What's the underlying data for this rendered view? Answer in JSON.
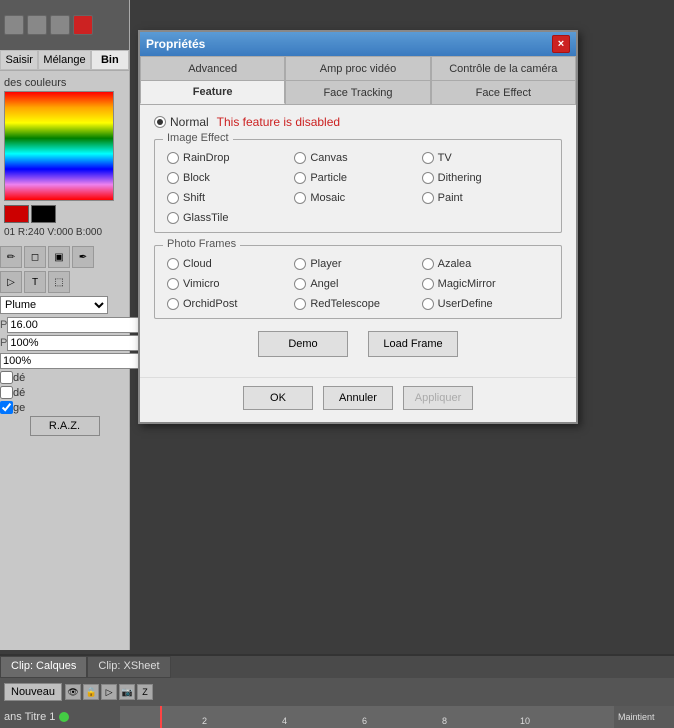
{
  "app": {
    "title": "Propriétés"
  },
  "sidebar": {
    "tabs": [
      "Saisir",
      "Mélange",
      "Bin"
    ],
    "active_tab": "Bin",
    "color_label": "des couleurs",
    "rgb_display": "01 R:240 V:000 B:000",
    "params": [
      {
        "label": "P",
        "value": "16.00"
      },
      {
        "label": "P",
        "value": "100%"
      },
      {
        "label": "",
        "value": "100%"
      }
    ],
    "raz_label": "R.A.Z."
  },
  "dialog": {
    "title": "Propriétés",
    "close_label": "×",
    "tabs": [
      {
        "label": "Advanced",
        "active": false
      },
      {
        "label": "Amp proc vidéo",
        "active": false
      },
      {
        "label": "Contrôle de la caméra",
        "active": false
      },
      {
        "label": "Feature",
        "active": true
      },
      {
        "label": "Face Tracking",
        "active": false
      },
      {
        "label": "Face Effect",
        "active": false
      }
    ],
    "feature_section": {
      "normal_label": "Normal",
      "disabled_text": "This feature is disabled"
    },
    "image_effect": {
      "title": "Image Effect",
      "items": [
        "RainDrop",
        "Canvas",
        "TV",
        "Block",
        "Particle",
        "Dithering",
        "Shift",
        "Mosaic",
        "Paint",
        "GlassTile"
      ]
    },
    "photo_frames": {
      "title": "Photo Frames",
      "items": [
        "Cloud",
        "Player",
        "Azalea",
        "Vimicro",
        "Angel",
        "MagicMirror",
        "OrchidPost",
        "RedTelescope",
        "UserDefine"
      ]
    },
    "demo_button": "Demo",
    "load_frame_button": "Load Frame",
    "footer": {
      "ok": "OK",
      "cancel": "Annuler",
      "apply": "Appliquer"
    }
  },
  "timeline": {
    "tabs": [
      "Clip: Calques",
      "Clip: XSheet"
    ],
    "active_tab": "Clip: Calques",
    "new_label": "Nouveau",
    "layer_label": "ans Titre 1",
    "time_label": "Maintient",
    "ruler_marks": [
      "",
      "2",
      "4",
      "6",
      "8",
      "10"
    ]
  }
}
